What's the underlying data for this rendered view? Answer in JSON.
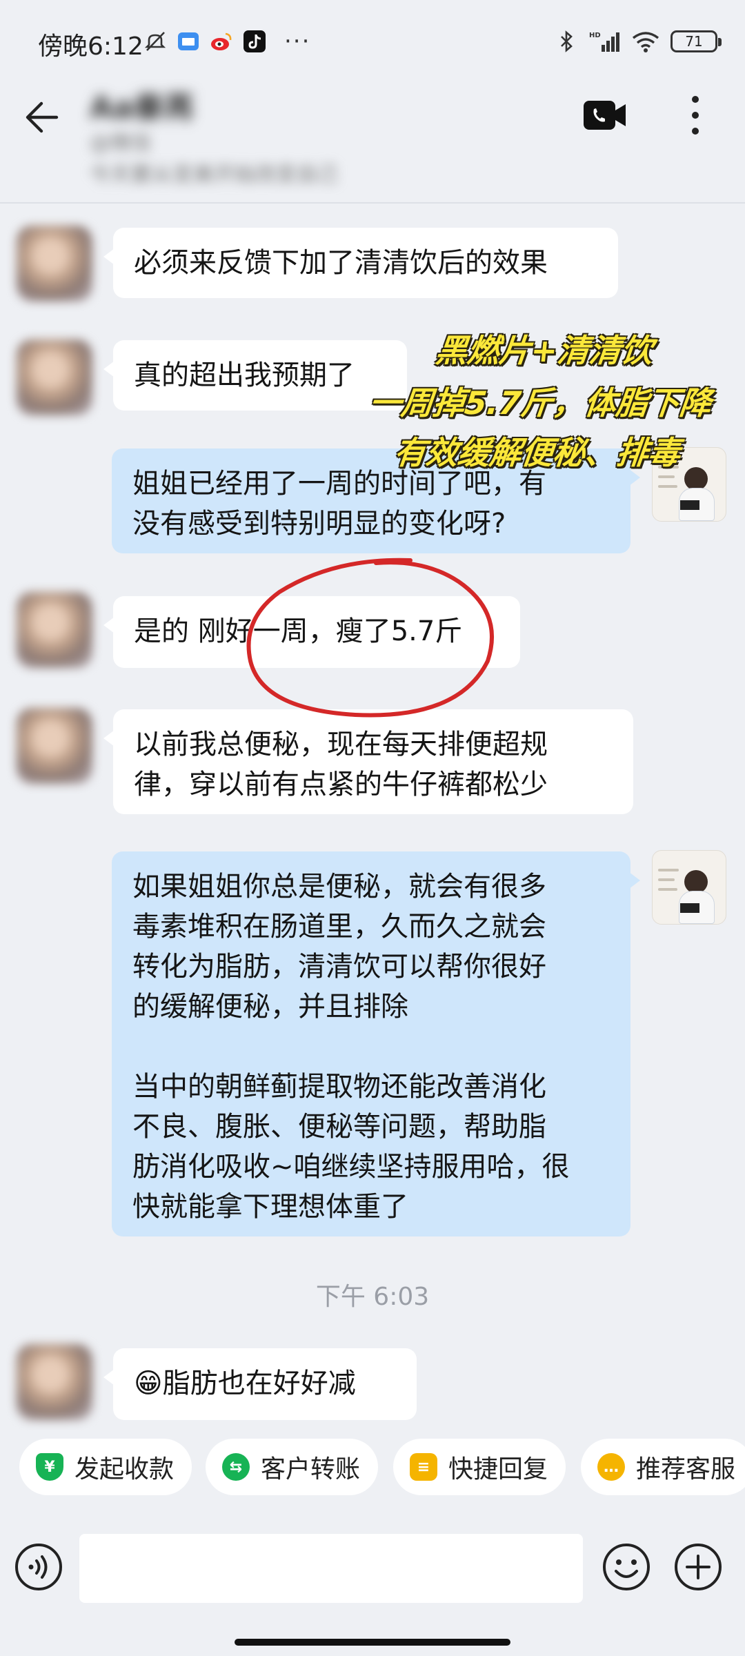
{
  "status_bar": {
    "time": "傍晚6:12",
    "more": "···",
    "battery": "71"
  },
  "header": {
    "contact_name": "Aa秦苒",
    "contact_sub": "@微信",
    "contact_sub2": "今天要从变美开始改变自己"
  },
  "messages": [
    {
      "side": "in",
      "text": "必须来反馈下加了清清饮后的效果"
    },
    {
      "side": "in",
      "text": "真的超出我预期了"
    },
    {
      "side": "out",
      "text": "姐姐已经用了一周的时间了吧，有\n没有感受到特别明显的变化呀?"
    },
    {
      "side": "in",
      "text": "是的 刚好一周，瘦了5.7斤"
    },
    {
      "side": "in",
      "text": "以前我总便秘，现在每天排便超规\n律，穿以前有点紧的牛仔裤都松少"
    },
    {
      "side": "out",
      "text": "如果姐姐你总是便秘，就会有很多\n毒素堆积在肠道里，久而久之就会\n转化为脂肪，清清饮可以帮你很好\n的缓解便秘，并且排除\n\n当中的朝鲜蓟提取物还能改善消化\n不良、腹胀、便秘等问题，帮助脂\n肪消化吸收~咱继续坚持服用哈，很\n快就能拿下理想体重了"
    },
    {
      "side": "in",
      "text": "😁脂肪也在好好减"
    }
  ],
  "time_divider": "下午 6:03",
  "overlay": {
    "line1": "黑燃片+清清饮",
    "line2": "一周掉5.7斤，体脂下降",
    "line3": "有效缓解便秘、排毒"
  },
  "quick_actions": [
    {
      "label": "发起收款",
      "icon": "yen-shield-icon",
      "color": "#17b355"
    },
    {
      "label": "客户转账",
      "icon": "transfer-icon",
      "color": "#17b355"
    },
    {
      "label": "快捷回复",
      "icon": "quick-reply-icon",
      "color": "#f5b400"
    },
    {
      "label": "推荐客服",
      "icon": "chat-bubble-icon",
      "color": "#f5b400"
    }
  ],
  "input": {
    "placeholder": ""
  }
}
